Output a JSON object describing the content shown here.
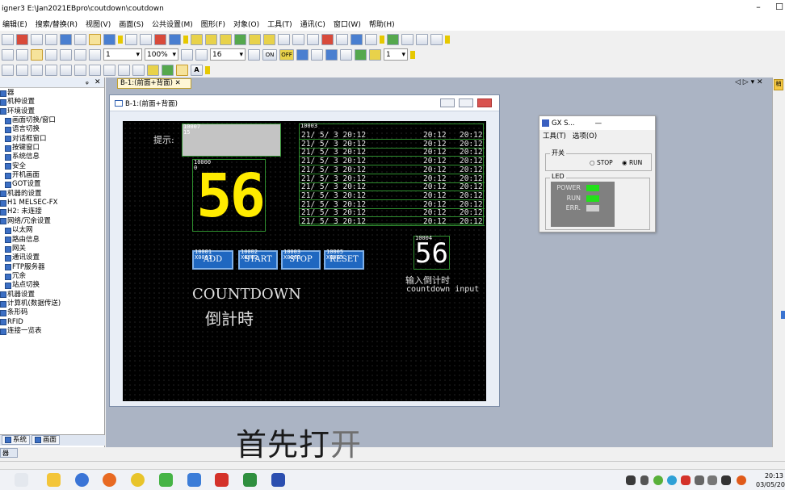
{
  "app": {
    "title": "igner3 E:\\Jan2021EBpro\\coutdown\\coutdown",
    "minimize": "–",
    "restore": "☐"
  },
  "menu": [
    "编辑(E)",
    "搜索/替换(R)",
    "视图(V)",
    "画面(S)",
    "公共设置(M)",
    "图形(F)",
    "对象(O)",
    "工具(T)",
    "通讯(C)",
    "窗口(W)",
    "帮助(H)"
  ],
  "toolbar": {
    "layer_value": "1",
    "zoom_value": "100%",
    "grid_value": "16",
    "on_label": "ON",
    "off_label": "OFF",
    "station_value": "1",
    "text_a_label": "A"
  },
  "left_pane": {
    "header_pin": "ᵩ",
    "header_close": "✕",
    "tree": [
      "器",
      "机种设置",
      "环境设置",
      "画面切换/窗口",
      "语言切换",
      "对话框窗口",
      "按键窗口",
      "系统信息",
      "安全",
      "开机画面",
      "GOT设置",
      "机器的设置",
      "H1 MELSEC-FX",
      "H2: 未连接",
      "网络/冗余设置",
      "以太网",
      "路由信息",
      "网关",
      "通讯设置",
      "FTP服务器",
      "冗余",
      "站点切换",
      "机器设置",
      "计算机(数据传送)",
      "条形码",
      "RFID",
      "连接一览表"
    ],
    "tabs": [
      "系统",
      "画面"
    ],
    "bottom_label": "器"
  },
  "doc_tab": {
    "label": "B-1:(前面+背面)",
    "close": "✕"
  },
  "right_nav": "◁ ▷ ▾ ✕",
  "right_strip_label": "稍",
  "screen_window": {
    "title": "B-1:(前面+背面)",
    "prompt_label": "提示:",
    "msg_tag": "10007\n15",
    "bignum_tag": "10000\n0",
    "countdown_value": "56",
    "log_tag": "10003",
    "log_rows": [
      {
        "c1": "21/ 5/ 3 20:12",
        "c2": "20:12",
        "c3": "20:12"
      },
      {
        "c1": "21/ 5/ 3 20:12",
        "c2": "20:12",
        "c3": "20:12"
      },
      {
        "c1": "21/ 5/ 3 20:12",
        "c2": "20:12",
        "c3": "20:12"
      },
      {
        "c1": "21/ 5/ 3 20:12",
        "c2": "20:12",
        "c3": "20:12"
      },
      {
        "c1": "21/ 5/ 3 20:12",
        "c2": "20:12",
        "c3": "20:12"
      },
      {
        "c1": "21/ 5/ 3 20:12",
        "c2": "20:12",
        "c3": "20:12"
      },
      {
        "c1": "21/ 5/ 3 20:12",
        "c2": "20:12",
        "c3": "20:12"
      },
      {
        "c1": "21/ 5/ 3 20:12",
        "c2": "20:12",
        "c3": "20:12"
      },
      {
        "c1": "21/ 5/ 3 20:12",
        "c2": "20:12",
        "c3": "20:12"
      },
      {
        "c1": "21/ 5/ 3 20:12",
        "c2": "20:12",
        "c3": "20:12"
      },
      {
        "c1": "21/ 5/ 3 20:12",
        "c2": "20:12",
        "c3": "20:12"
      }
    ],
    "buttons": [
      {
        "tag": "10001\nX0001",
        "label": "ADD"
      },
      {
        "tag": "10002\nX0002",
        "label": "START"
      },
      {
        "tag": "10003\nX0003",
        "label": "STOP"
      },
      {
        "tag": "10005\nX0005",
        "label": "RESET"
      }
    ],
    "input_tag": "10004",
    "input_value": "56",
    "input_label_cn": "输入倒计时",
    "input_label_en": "countdown input",
    "countdown_en": "COUNTDOWN",
    "countdown_cn": "倒計時"
  },
  "gx_dialog": {
    "title": "GX S...",
    "title_min": "—",
    "menu": [
      "工具(T)",
      "选项(O)"
    ],
    "switch_group": "开关",
    "stop_label": "STOP",
    "run_label": "RUN",
    "selected": "RUN",
    "led_group": "LED",
    "leds": [
      {
        "name": "POWER",
        "color": "#22e01a"
      },
      {
        "name": "RUN",
        "color": "#22e01a"
      },
      {
        "name": "ERR.",
        "color": "#cfcfcf"
      }
    ]
  },
  "subtitle": {
    "main": "首先打",
    "faded": "开"
  },
  "clock": {
    "time": "20:13",
    "date": "03/05/20"
  },
  "colors": {
    "canvas": "#000000",
    "grid_line": "#2f8f2f",
    "button": "#1f67c0",
    "digit": "#ffeb00",
    "led_on": "#22e01a"
  }
}
